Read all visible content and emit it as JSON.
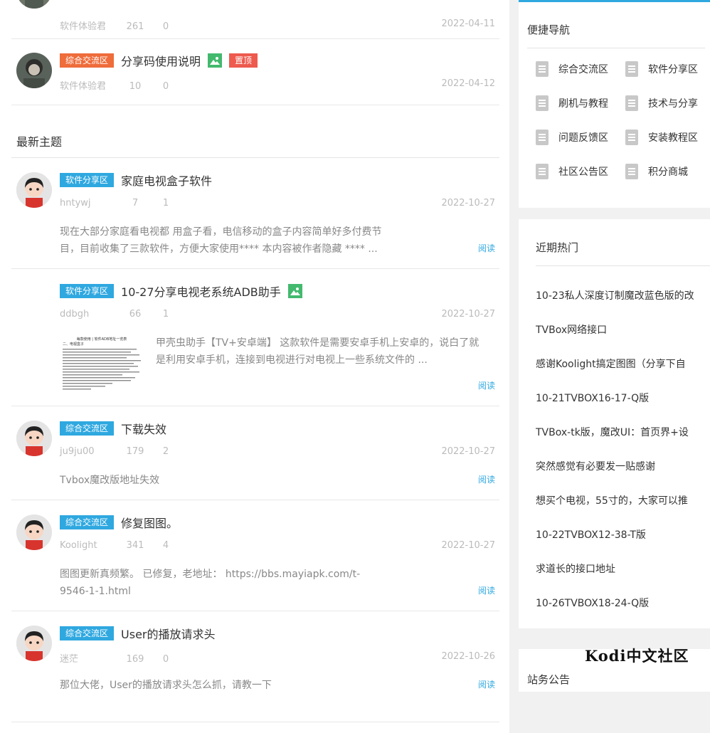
{
  "pinned_posts": [
    {
      "category": "综合交流区",
      "title": "分享码使用说明",
      "author": "软件体验君",
      "views": "10",
      "replies": "0",
      "date": "2022-04-12",
      "top_label": "置顶"
    }
  ],
  "partial_post": {
    "author": "软件体验君",
    "views": "261",
    "replies": "0",
    "date": "2022-04-11"
  },
  "section_title": "最新主题",
  "posts": [
    {
      "category": "软件分享区",
      "title": "家庭电视盒子软件",
      "author": "hntywj",
      "views": "7",
      "replies": "1",
      "date": "2022-10-27",
      "excerpt": "现在大部分家庭看电视都 用盒子看，电信移动的盒子内容简单好多付费节目，目前收集了三款软件，方便大家使用**** 本内容被作者隐藏 **** ...",
      "read": "阅读"
    },
    {
      "category": "软件分享区",
      "title": "10-27分享电视老系统ADB助手",
      "author": "ddbgh",
      "views": "66",
      "replies": "1",
      "date": "2022-10-27",
      "excerpt": "甲壳虫助手【TV+安卓端】 这款软件是需要安卓手机上安卓的，说白了就是利用安卓手机，连接到电视进行对电视上一些系统文件的 ...",
      "read": "阅读",
      "thumb_heading": "每款使用 | 软件ADB地址一览表",
      "thumb_sub": "二、电视盒子"
    },
    {
      "category": "综合交流区",
      "title": "下载失效",
      "author": "ju9ju00",
      "views": "179",
      "replies": "2",
      "date": "2022-10-27",
      "excerpt": "Tvbox魔改版地址失效",
      "read": "阅读"
    },
    {
      "category": "综合交流区",
      "title": "修复图图。",
      "author": "Koolight",
      "views": "341",
      "replies": "4",
      "date": "2022-10-27",
      "excerpt": "图图更新真频繁。 已修复，老地址： https://bbs.mayiapk.com/t-9546-1-1.html",
      "read": "阅读"
    },
    {
      "category": "综合交流区",
      "title": "User的播放请求头",
      "author": "迷茫",
      "views": "169",
      "replies": "0",
      "date": "2022-10-26",
      "excerpt": "那位大佬，User的播放请求头怎么抓，请教一下",
      "read": "阅读"
    }
  ],
  "sidebar": {
    "nav_title": "便捷导航",
    "nav_items": [
      "综合交流区",
      "软件分享区",
      "刷机与教程",
      "技术与分享",
      "问题反馈区",
      "安装教程区",
      "社区公告区",
      "积分商城"
    ],
    "hot_title": "近期热门",
    "hot_items": [
      "10-23私人深度订制魔改蓝色版的改",
      "TVBox网络接口",
      "感谢Koolight搞定图图（分享下自",
      "10-21TVBOX16-17-Q版",
      "TVBox-tk版，魔改UI：首页界+设",
      "突然感觉有必要发一贴感谢",
      "想买个电视，55寸的，大家可以推",
      "10-22TVBOX12-38-T版",
      "求道长的接口地址",
      "10-26TVBOX18-24-Q版"
    ],
    "notice_title": "站务公告"
  },
  "watermark": "Kodi中文社区",
  "colors": {
    "accent": "#2fa8e0",
    "cat_blue": "#2fa8e0",
    "cat_orange": "#ef6c3b",
    "top_red": "#ee5a4e",
    "img_green": "#43b96e"
  }
}
